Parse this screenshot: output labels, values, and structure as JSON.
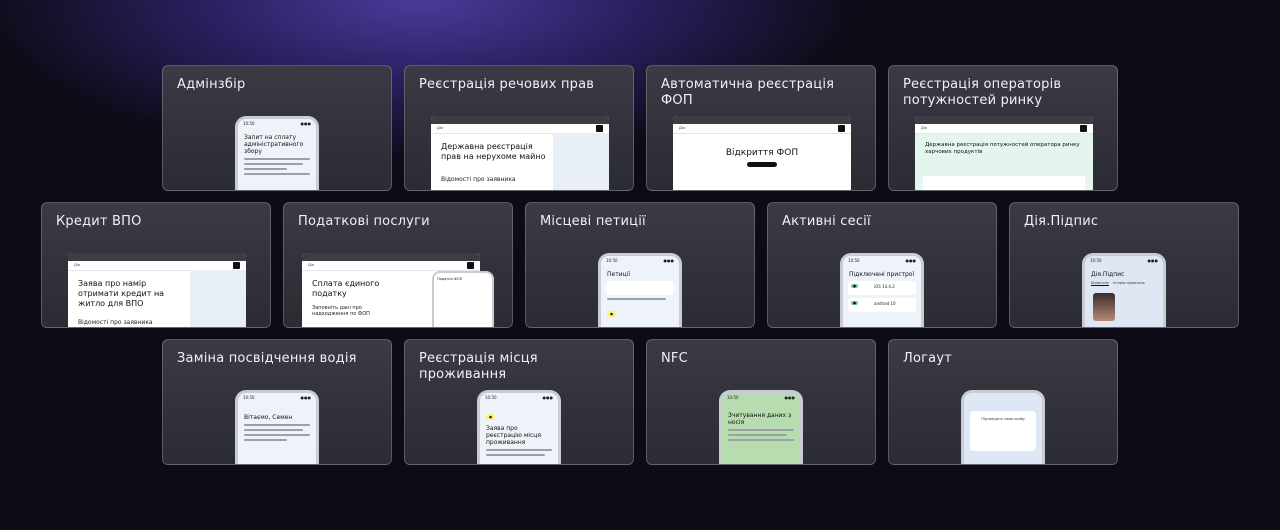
{
  "cards": {
    "adminzbir": {
      "title": "Адмінзбір",
      "screen_title": "Запит на сплату адміністративного збору",
      "time": "10:50"
    },
    "rechovi_prava": {
      "title": "Реєстрація речових прав",
      "screen_title": "Державна реєстрація прав на нерухоме майно",
      "screen_sub": "Відомості про заявника"
    },
    "fop": {
      "title": "Автоматична реєстрація ФОП",
      "screen_title": "Відкриття ФОП"
    },
    "operators": {
      "title": "Реєстрація операторів потужностей ринку",
      "screen_title": "Державна реєстрація потужностей оператора ринку харчових продуктів"
    },
    "kredyt_vpo": {
      "title": "Кредит ВПО",
      "screen_title": "Заява про намір отримати кредит на житло для ВПО",
      "screen_sub": "Відомості про заявника"
    },
    "podatkovi": {
      "title": "Податкові послуги",
      "screen_title": "Сплата єдиного податку",
      "screen_sub": "Заповніть дані про надходження по ФОП",
      "overlay_title": "Податки ФОП"
    },
    "petytsii": {
      "title": "Місцеві петиції",
      "screen_title": "Петиції",
      "time": "10:50"
    },
    "sesii": {
      "title": "Активні сесії",
      "screen_title": "Підключені пристрої",
      "device_1": "iOS 14.4.2",
      "device_2": "android 10",
      "time": "10:50"
    },
    "dia_pidpys": {
      "title": "Дія.Підпис",
      "screen_title": "Дія.Підпис",
      "tab_1": "Біометрія",
      "tab_2": "Історія підписань",
      "time": "10:50"
    },
    "posvidchennia": {
      "title": "Заміна посвідчення водія",
      "screen_title": "Вітаємо, Семен",
      "time": "10:50"
    },
    "prozhyvannia": {
      "title": "Реєстрація місця проживання",
      "screen_title": "Заява про реєстрацію місця проживання",
      "time": "10:50"
    },
    "nfc": {
      "title": "NFC",
      "screen_title": "Зчитування даних з носія",
      "time": "10:50"
    },
    "logaut": {
      "title": "Логаут",
      "screen_title": "Підтвердіть свою особу"
    }
  }
}
